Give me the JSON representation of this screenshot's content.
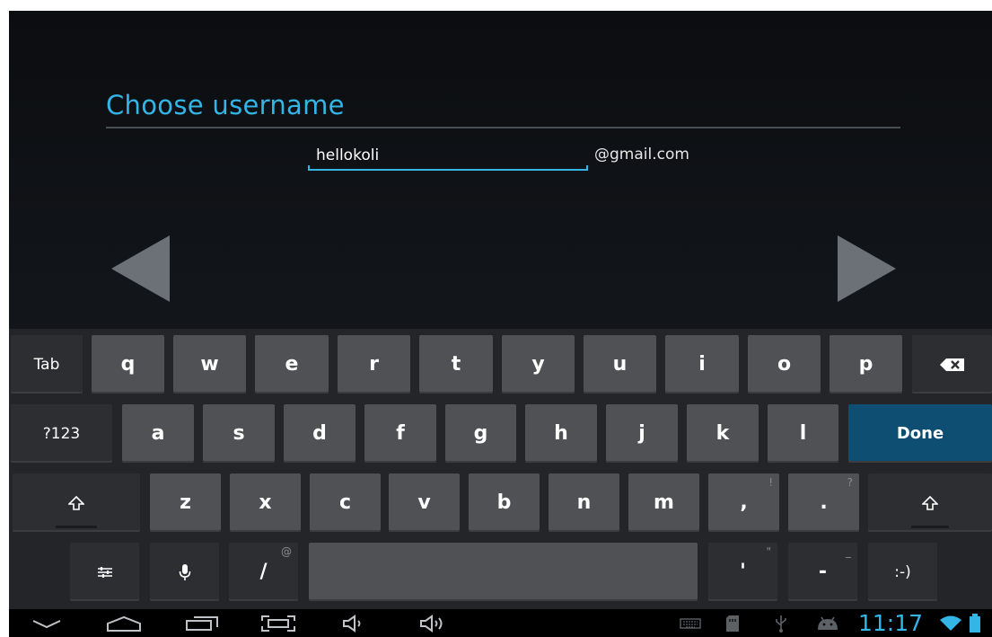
{
  "form": {
    "title": "Choose username",
    "username_value": "hellokoli",
    "domain_suffix": "@gmail.com"
  },
  "keyboard": {
    "row1": [
      "Tab",
      "q",
      "w",
      "e",
      "r",
      "t",
      "y",
      "u",
      "i",
      "o",
      "p"
    ],
    "row2": [
      "?123",
      "a",
      "s",
      "d",
      "f",
      "g",
      "h",
      "j",
      "k",
      "l",
      "Done"
    ],
    "row3": [
      "z",
      "x",
      "c",
      "v",
      "b",
      "n",
      "m",
      ",",
      "."
    ],
    "row3_hints": {
      "comma": "!",
      "period": "?"
    },
    "row4": {
      "slash": "/",
      "slash_hint": "@",
      "apostrophe": "'",
      "apostrophe_hint": "\"",
      "dash": "-",
      "dash_hint": "_",
      "smiley": ":-)"
    }
  },
  "icons": {
    "backspace": "backspace-icon",
    "shift": "shift-icon",
    "settings": "settings-icon",
    "mic": "microphone-icon",
    "back": "back-icon",
    "home": "home-icon",
    "recents": "recents-icon",
    "screenshot": "screenshot-icon",
    "volume_down": "volume-down-icon",
    "volume_up": "volume-up-icon"
  },
  "status_bar": {
    "time": "11:17"
  },
  "colors": {
    "accent": "#33b5e5",
    "done_key": "#0e4e73",
    "key": "#4f5154",
    "key_dark": "#2c2e31"
  }
}
